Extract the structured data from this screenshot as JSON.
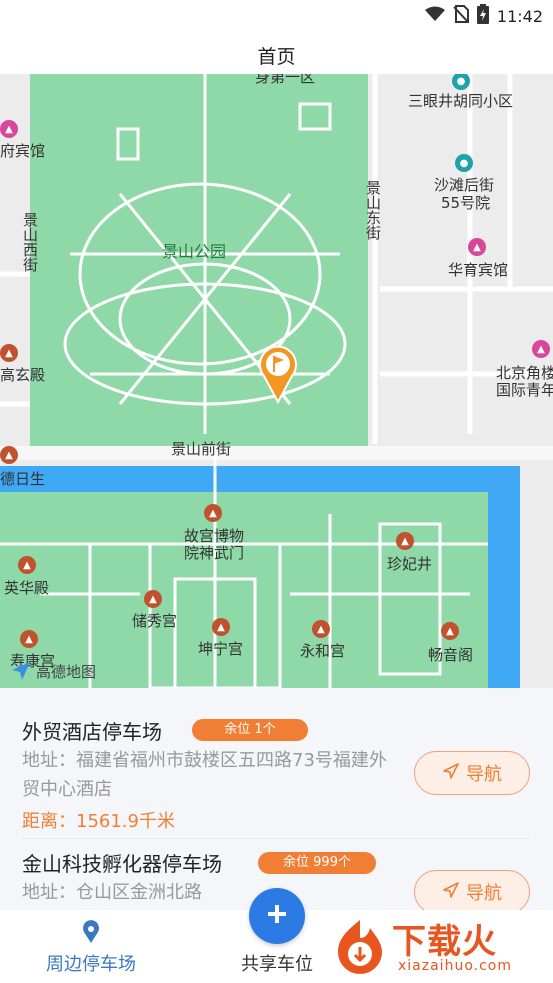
{
  "status_bar": {
    "time": "11:42"
  },
  "header": {
    "title": "首页"
  },
  "map": {
    "labels": {
      "park": "景山公园",
      "sanyanjing": "三眼井胡同小区",
      "shatan_1": "沙滩后街",
      "shatan_2": "55号院",
      "jingshan_east": "景山东街",
      "jingshan_west": "景山西街",
      "huayu": "华育宾馆",
      "fu_hotel": "府宾馆",
      "beijing_1": "北京角楼",
      "beijing_2": "国际青年",
      "xuan": "高玄殿",
      "front_street": "景山前街",
      "deri": "德日生",
      "gugong_1": "故宫博物",
      "gugong_2": "院神武门",
      "zhenfei": "珍妃井",
      "yinghua": "英华殿",
      "chuxiu": "储秀宫",
      "kunning": "坤宁宫",
      "yonghe": "永和宫",
      "changyin": "畅音阁",
      "shoukang": "寿康宫",
      "top_road": "身第一区"
    },
    "logo_text": "高德地图"
  },
  "listings": [
    {
      "name": "外贸酒店停车场",
      "badge": "余位 1个",
      "address": "地址：福建省福州市鼓楼区五四路73号福建外贸中心酒店",
      "distance": "距离：1561.9千米",
      "nav_label": "导航"
    },
    {
      "name": "金山科技孵化器停车场",
      "badge": "余位 999个",
      "address": "地址：仓山区金洲北路",
      "nav_label": "导航"
    }
  ],
  "tabbar": {
    "nearby_label": "周边停车场",
    "share_label": "共享车位"
  },
  "watermark": {
    "text": "下载火",
    "sub": "xiazaihuo.com"
  },
  "colors": {
    "accent": "#f07f35",
    "primary": "#2c7be5",
    "park": "#8fd9a8",
    "water": "#3fa9f5"
  }
}
